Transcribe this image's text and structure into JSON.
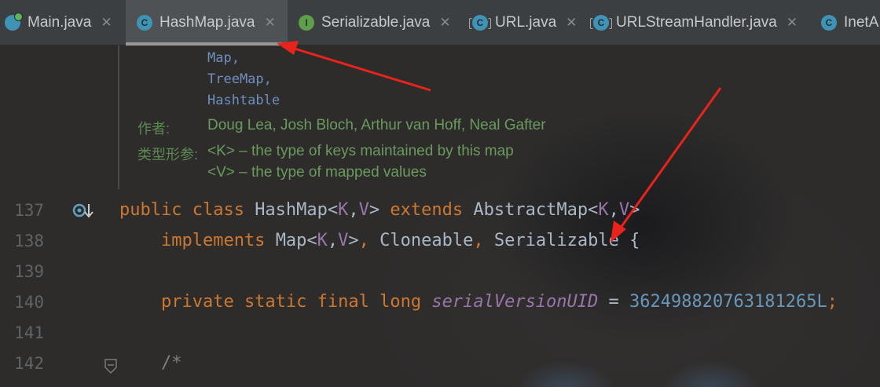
{
  "tabs": [
    {
      "label": "Main.java",
      "icon": "class-run-icon",
      "letter": ""
    },
    {
      "label": "HashMap.java",
      "icon": "class-icon",
      "letter": "C"
    },
    {
      "label": "Serializable.java",
      "icon": "interface-icon",
      "letter": "I"
    },
    {
      "label": "URL.java",
      "icon": "class-lock-icon",
      "letter": "C"
    },
    {
      "label": "URLStreamHandler.java",
      "icon": "class-lock-icon",
      "letter": "C"
    },
    {
      "label": "InetA",
      "icon": "class-icon",
      "letter": "C"
    }
  ],
  "close_glyph": "✕",
  "javadoc": {
    "see_items": [
      "Map,",
      "TreeMap,",
      "Hashtable"
    ],
    "author_label": "作者:",
    "author_value": "Doug Lea, Josh Bloch, Arthur van Hoff, Neal Gafter",
    "type_params_label": "类型形参:",
    "type_params": [
      "<K> – the type of keys maintained by this map",
      "<V> – the type of mapped values"
    ]
  },
  "lines": [
    {
      "num": "137",
      "tokens": [
        [
          "kw",
          "public class "
        ],
        [
          "pl",
          "HashMap<"
        ],
        [
          "tp",
          "K"
        ],
        [
          "pl",
          ","
        ],
        [
          "tp",
          "V"
        ],
        [
          "pl",
          "> "
        ],
        [
          "kw",
          "extends "
        ],
        [
          "pl",
          "AbstractMap<"
        ],
        [
          "tp",
          "K"
        ],
        [
          "pl",
          ","
        ],
        [
          "tp",
          "V"
        ],
        [
          "pl",
          ">"
        ]
      ]
    },
    {
      "num": "138",
      "tokens": [
        [
          "kw",
          "    implements "
        ],
        [
          "pl",
          "Map<"
        ],
        [
          "tp",
          "K"
        ],
        [
          "pl",
          ","
        ],
        [
          "tp",
          "V"
        ],
        [
          "pl",
          ">"
        ],
        [
          "kw",
          ", "
        ],
        [
          "pl",
          "Cloneable"
        ],
        [
          "kw",
          ", "
        ],
        [
          "pl",
          "Serializable {"
        ]
      ]
    },
    {
      "num": "139",
      "tokens": []
    },
    {
      "num": "140",
      "tokens": [
        [
          "kw",
          "    private static final long "
        ],
        [
          "fld",
          "serialVersionUID"
        ],
        [
          "pl",
          " = "
        ],
        [
          "num",
          "362498820763181265L"
        ],
        [
          "kw",
          ";"
        ]
      ]
    },
    {
      "num": "141",
      "tokens": []
    },
    {
      "num": "142",
      "tokens": [
        [
          "cmt",
          "    /*"
        ]
      ]
    }
  ],
  "colors": {
    "keyword": "#cc7832",
    "type_param": "#9876aa",
    "number": "#6897bb",
    "doc_text": "#6a9a5e",
    "annotation_arrow": "#e8231b"
  }
}
